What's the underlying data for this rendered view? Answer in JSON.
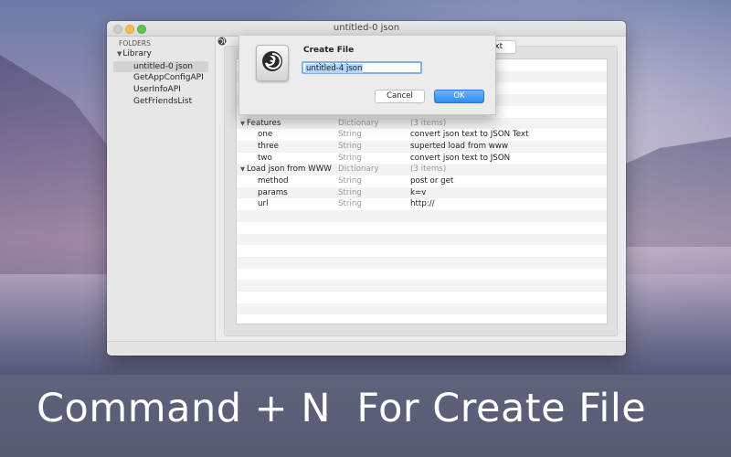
{
  "window": {
    "title": "untitled-0 json",
    "status": ""
  },
  "sidebar": {
    "header": "FOLDERS",
    "root_label": "Library",
    "items": [
      {
        "label": "untitled-0 json",
        "selected": true
      },
      {
        "label": "GetAppConfigAPI",
        "selected": false
      },
      {
        "label": "UserInfoAPI",
        "selected": false
      },
      {
        "label": "GetFriendsList",
        "selected": false
      }
    ]
  },
  "toolbar": {
    "text_button": "ext"
  },
  "table": {
    "rows": [
      {
        "key": "",
        "type": "",
        "value": "",
        "indent": 0
      },
      {
        "key": "",
        "type": "",
        "value": "",
        "indent": 0
      },
      {
        "key": "",
        "type": "",
        "value": "",
        "indent": 0
      },
      {
        "key": "",
        "type": "",
        "value": "",
        "indent": 0
      },
      {
        "key": "[2]",
        "type": "String",
        "value": "more...",
        "indent": 1
      },
      {
        "key": "Features",
        "type": "Dictionary",
        "value": "(3 items)",
        "indent": 0,
        "expanded": true
      },
      {
        "key": "one",
        "type": "String",
        "value": "convert json text to JSON Text",
        "indent": 1
      },
      {
        "key": "three",
        "type": "String",
        "value": "superted load from www",
        "indent": 1
      },
      {
        "key": "two",
        "type": "String",
        "value": "convert json text to JSON",
        "indent": 1
      },
      {
        "key": "Load json from WWW",
        "type": "Dictionary",
        "value": "(3 items)",
        "indent": 0,
        "expanded": true
      },
      {
        "key": "method",
        "type": "String",
        "value": "post or get",
        "indent": 1
      },
      {
        "key": "params",
        "type": "String",
        "value": "k=v",
        "indent": 1
      },
      {
        "key": "url",
        "type": "String",
        "value": "http://",
        "indent": 1
      }
    ]
  },
  "dialog": {
    "title": "Create File",
    "input_value": "untitled-4 json",
    "cancel_label": "Cancel",
    "ok_label": "OK"
  },
  "caption": "Command + N  For Create File",
  "colors": {
    "accent": "#2e8cf0",
    "selection": "#b3d4fc"
  }
}
